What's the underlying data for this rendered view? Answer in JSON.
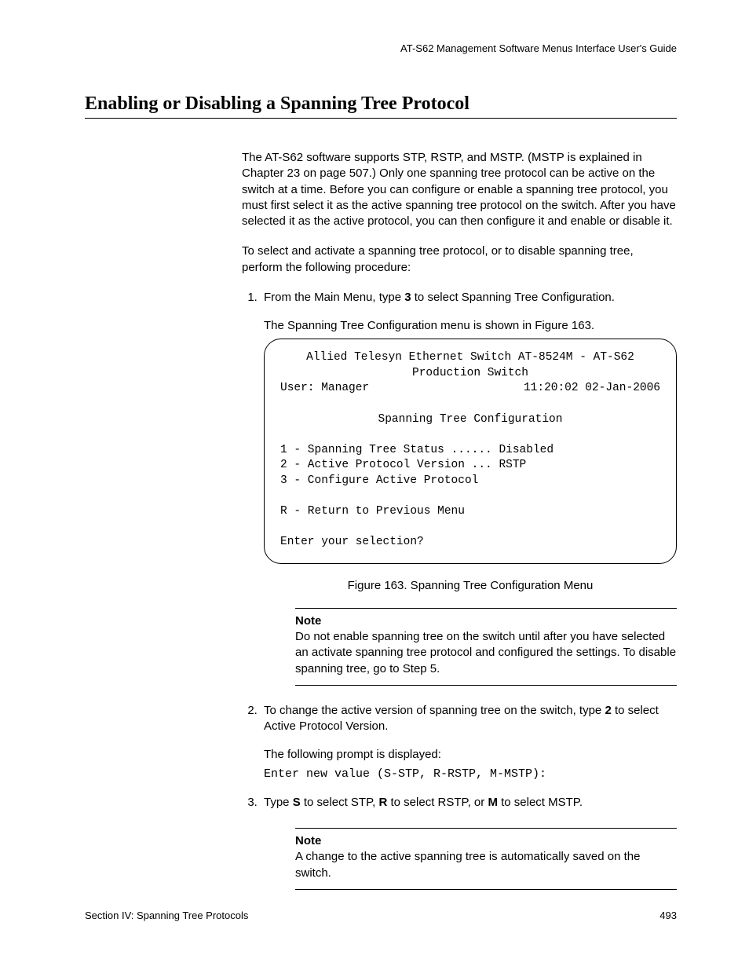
{
  "header": {
    "guide_title": "AT-S62 Management Software Menus Interface User's Guide"
  },
  "title": "Enabling or Disabling a Spanning Tree Protocol",
  "intro": {
    "p1": "The AT-S62 software supports STP, RSTP, and MSTP. (MSTP is explained in Chapter 23 on page 507.) Only one spanning tree protocol can be active on the switch at a time. Before you can configure or enable a spanning tree protocol, you must first select it as the active spanning tree protocol on the switch. After you have selected it as the active protocol, you can then configure it and enable or disable it.",
    "p2": "To select and activate a spanning tree protocol, or to disable spanning tree, perform the following procedure:"
  },
  "steps": {
    "s1_a": "From the Main Menu, type ",
    "s1_bold": "3",
    "s1_b": " to select Spanning Tree Configuration.",
    "s1_sub": "The Spanning Tree Configuration menu is shown in Figure 163.",
    "s2_a": "To change the active version of spanning tree on the switch, type ",
    "s2_bold": "2",
    "s2_b": " to select Active Protocol Version.",
    "s2_sub": "The following prompt is displayed:",
    "s2_prompt": "Enter new value (S-STP, R-RSTP, M-MSTP):",
    "s3_a": "Type ",
    "s3_b1": "S",
    "s3_c": " to select STP, ",
    "s3_b2": "R",
    "s3_d": " to select RSTP, or ",
    "s3_b3": "M",
    "s3_e": " to select MSTP."
  },
  "menu": {
    "line1": "Allied Telesyn Ethernet Switch AT-8524M - AT-S62",
    "line2": "Production Switch",
    "user_label": "User: Manager",
    "timestamp": "11:20:02 02-Jan-2006",
    "title": "Spanning Tree Configuration",
    "opt1": "1 - Spanning Tree Status ...... Disabled",
    "opt2": "2 - Active Protocol Version ... RSTP",
    "opt3": "3 - Configure Active Protocol",
    "optR": "R - Return to Previous Menu",
    "prompt": "Enter your selection?"
  },
  "figure_caption": "Figure 163. Spanning Tree Configuration Menu",
  "notes": {
    "label": "Note",
    "n1": "Do not enable spanning tree on the switch until after you have selected an activate spanning tree protocol and configured the settings. To disable spanning tree, go to Step 5.",
    "n2": "A change to the active spanning tree is automatically saved on the switch."
  },
  "footer": {
    "section": "Section IV: Spanning Tree Protocols",
    "page": "493"
  }
}
